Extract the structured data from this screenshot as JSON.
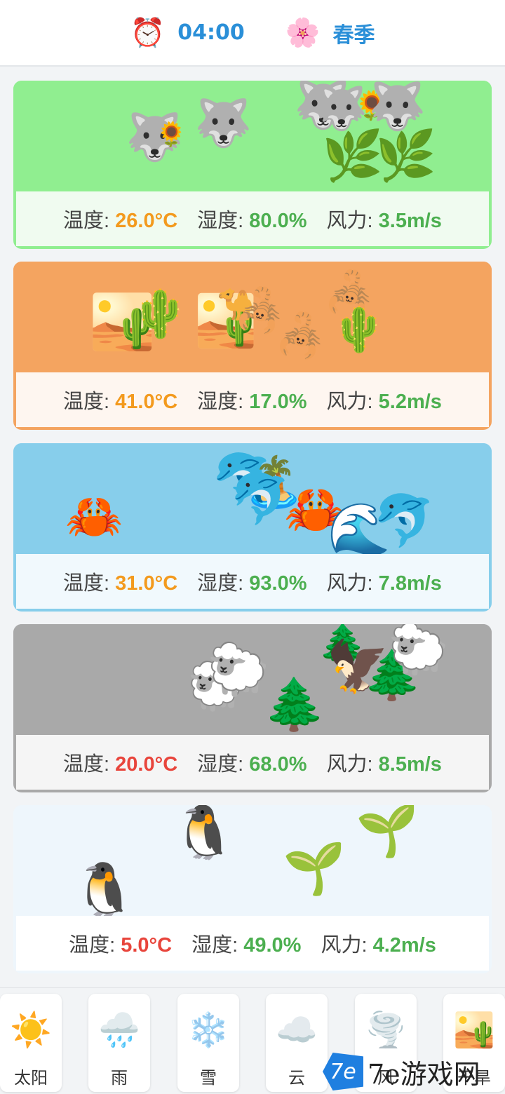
{
  "header": {
    "time_icon": "alarm-clock-icon",
    "time_glyph": "⏰",
    "time": "04:00",
    "season_icon": "cherry-blossom-icon",
    "season_glyph": "🌸",
    "season": "春季"
  },
  "labels": {
    "temp": "温度: ",
    "humidity": "湿度: ",
    "wind": "风力: "
  },
  "biomes": [
    {
      "name": "grassland",
      "bg": "#90ee90",
      "stats_bg": "#f0fbf0",
      "temp": "26.0°C",
      "humidity": "80.0%",
      "wind": "3.5m/s",
      "emojis": [
        "🐺",
        "🌻",
        "🐺",
        "🐺",
        "🐺",
        "🌻",
        "🐺",
        "🌿",
        "🌿"
      ]
    },
    {
      "name": "desert",
      "bg": "#f4a460",
      "stats_bg": "#fef6f0",
      "temp": "41.0°C",
      "humidity": "17.0%",
      "wind": "5.2m/s",
      "emojis": [
        "🏜️",
        "🌵",
        "🏜️",
        "🐪",
        "🦂",
        "🦂",
        "🦂",
        "🌵"
      ]
    },
    {
      "name": "ocean",
      "bg": "#87ceeb",
      "stats_bg": "#f1f9fd",
      "temp": "31.0°C",
      "humidity": "93.0%",
      "wind": "7.8m/s",
      "emojis": [
        "🦀",
        "🐬",
        "🏝️",
        "🐬",
        "🦀",
        "🌊",
        "🐬"
      ]
    },
    {
      "name": "forest",
      "bg": "#a9a9a9",
      "stats_bg": "#f5f5f5",
      "temp": "20.0°C",
      "humidity": "68.0%",
      "wind": "8.5m/s",
      "emojis": [
        "🐑",
        "🐑",
        "🌲",
        "🌲",
        "🦅",
        "🌲",
        "🐑"
      ]
    },
    {
      "name": "tundra",
      "bg": "#eef6fc",
      "stats_bg": "#ffffff",
      "temp": "5.0°C",
      "humidity": "49.0%",
      "wind": "4.2m/s",
      "emojis": [
        "🐧",
        "🐧",
        "🌱",
        "🌱"
      ]
    }
  ],
  "tools": [
    {
      "icon": "sun-icon",
      "glyph": "☀️",
      "label": "太阳"
    },
    {
      "icon": "rain-cloud-icon",
      "glyph": "🌧️",
      "label": "雨"
    },
    {
      "icon": "snowflake-icon",
      "glyph": "❄️",
      "label": "雪"
    },
    {
      "icon": "cloud-icon",
      "glyph": "☁️",
      "label": "云"
    },
    {
      "icon": "tornado-icon",
      "glyph": "🌪️",
      "label": "风"
    },
    {
      "icon": "desert-icon",
      "glyph": "🏜️",
      "label": "干旱"
    }
  ],
  "watermark": {
    "logo": "7e",
    "text": "7e游戏网"
  }
}
